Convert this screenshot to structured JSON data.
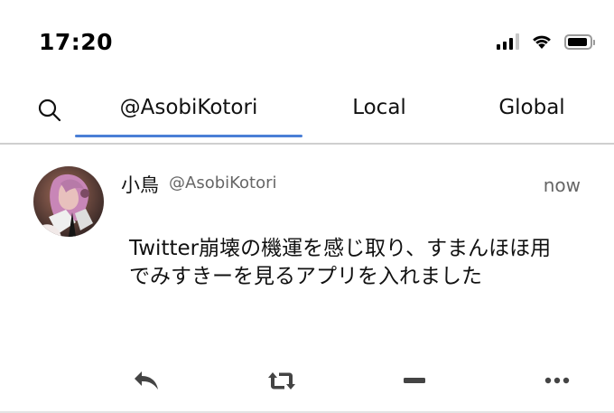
{
  "status_bar": {
    "time": "17:20",
    "icons": [
      "cellular-signal-icon",
      "wifi-icon",
      "battery-icon"
    ]
  },
  "tabs": {
    "search_icon": "search-icon",
    "items": [
      {
        "label": "@AsobiKotori",
        "active": true
      },
      {
        "label": "Local",
        "active": false
      },
      {
        "label": "Global",
        "active": false
      }
    ],
    "accent_color": "#4a7fd6"
  },
  "post": {
    "display_name": "小鳥",
    "username": "@AsobiKotori",
    "timestamp": "now",
    "text": "Twitter崩壊の機運を感じ取り、すまんほほ用でみすきーを見るアプリを入れました",
    "actions": [
      "reply-icon",
      "renote-icon",
      "reaction-icon",
      "more-icon"
    ]
  },
  "colors": {
    "text": "#111111",
    "muted": "#666666",
    "divider": "#cfcfcf"
  }
}
